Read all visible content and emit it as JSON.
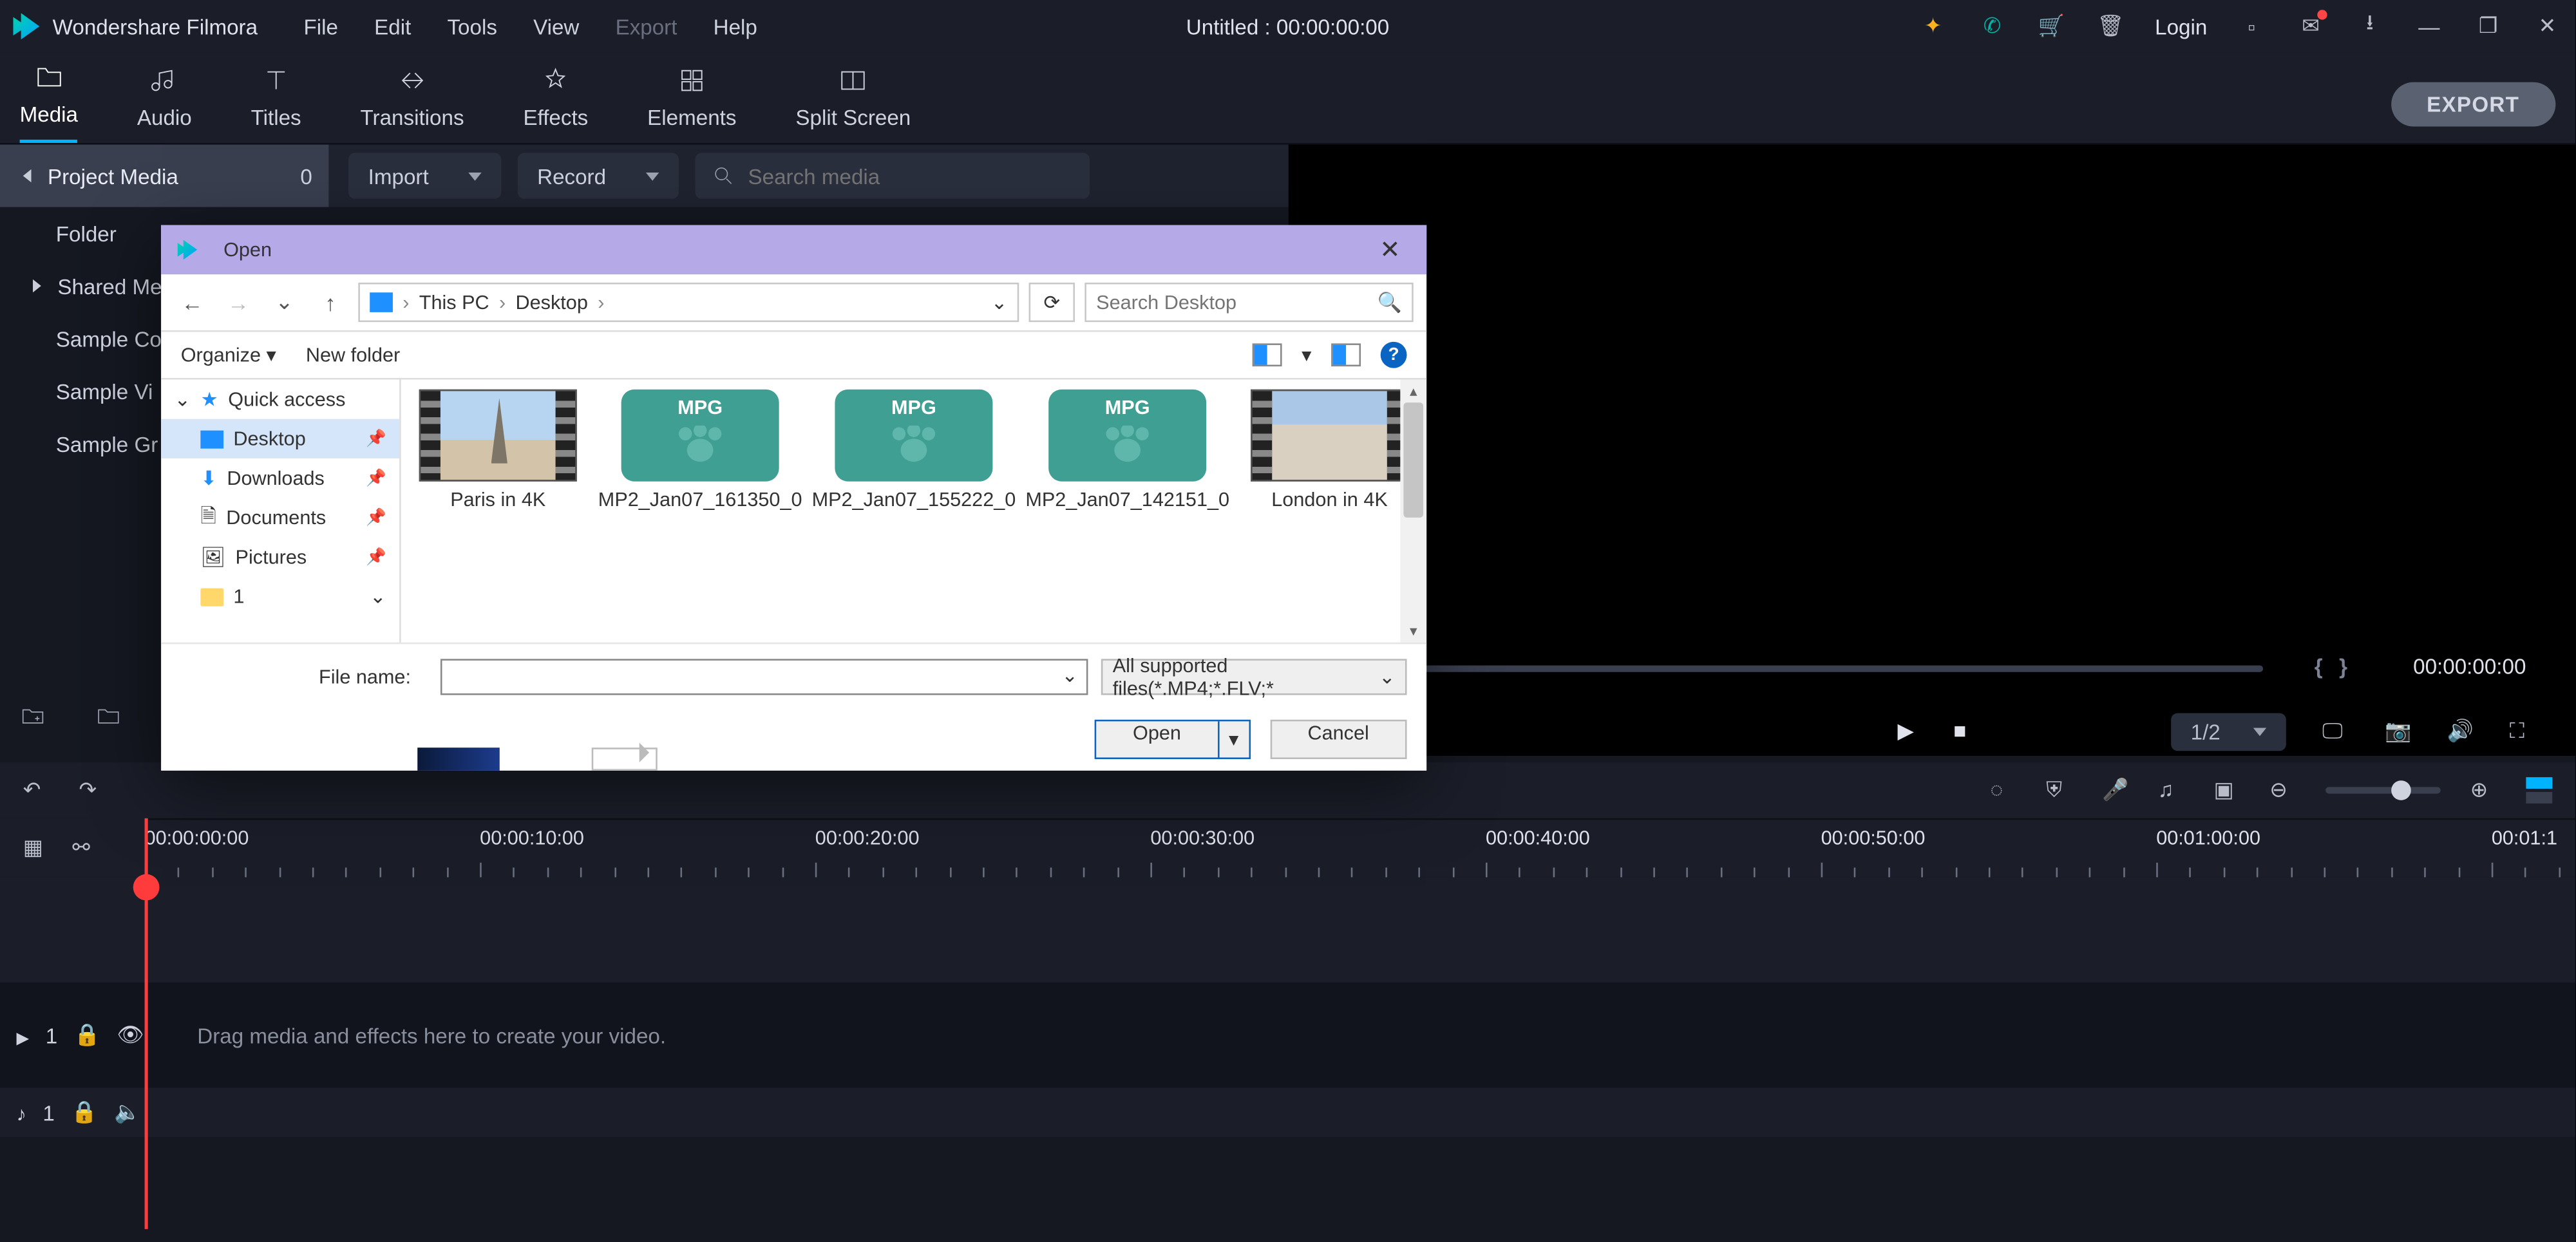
{
  "app": {
    "name": "Wondershare Filmora"
  },
  "menu": {
    "file": "File",
    "edit": "Edit",
    "tools": "Tools",
    "view": "View",
    "export": "Export",
    "help": "Help"
  },
  "title_center": "Untitled : 00:00:00:00",
  "titlebar_right": {
    "login": "Login"
  },
  "tabs": {
    "media": "Media",
    "audio": "Audio",
    "titles": "Titles",
    "transitions": "Transitions",
    "effects": "Effects",
    "elements": "Elements",
    "split": "Split Screen"
  },
  "export_btn": "EXPORT",
  "subbar": {
    "project_media": "Project Media",
    "count": "0",
    "import": "Import",
    "record": "Record",
    "search_ph": "Search media"
  },
  "tree": {
    "folder": "Folder",
    "shared": "Shared Me",
    "sampleco": "Sample Co",
    "samplevi": "Sample Vi",
    "samplegr": "Sample Gr"
  },
  "preview": {
    "brace_l": "{",
    "brace_r": "}",
    "tc": "00:00:00:00",
    "ratio": "1/2"
  },
  "ruler": [
    "00:00:00:00",
    "00:00:10:00",
    "00:00:20:00",
    "00:00:30:00",
    "00:00:40:00",
    "00:00:50:00",
    "00:01:00:00",
    "00:01:1"
  ],
  "track": {
    "video": "1",
    "audio": "1",
    "drop_hint": "Drag media and effects here to create your video."
  },
  "dialog": {
    "title": "Open",
    "path": {
      "root": "This PC",
      "leaf": "Desktop"
    },
    "search_ph": "Search Desktop",
    "toolbar": {
      "organize": "Organize",
      "newfolder": "New folder"
    },
    "side": {
      "quick": "Quick access",
      "desktop": "Desktop",
      "downloads": "Downloads",
      "documents": "Documents",
      "pictures": "Pictures",
      "one": "1"
    },
    "files": [
      {
        "label": "London in 4K",
        "type": "vid"
      },
      {
        "label": "MP2_Jan07_142151_0",
        "type": "mpg"
      },
      {
        "label": "MP2_Jan07_155222_0",
        "type": "mpg"
      },
      {
        "label": "MP2_Jan07_161350_0",
        "type": "mpg"
      },
      {
        "label": "Paris in 4K",
        "type": "vid"
      }
    ],
    "mpg_label": "MPG",
    "fn_label": "File name:",
    "filetype": "All supported files(*.MP4;*.FLV;*",
    "open": "Open",
    "cancel": "Cancel"
  }
}
